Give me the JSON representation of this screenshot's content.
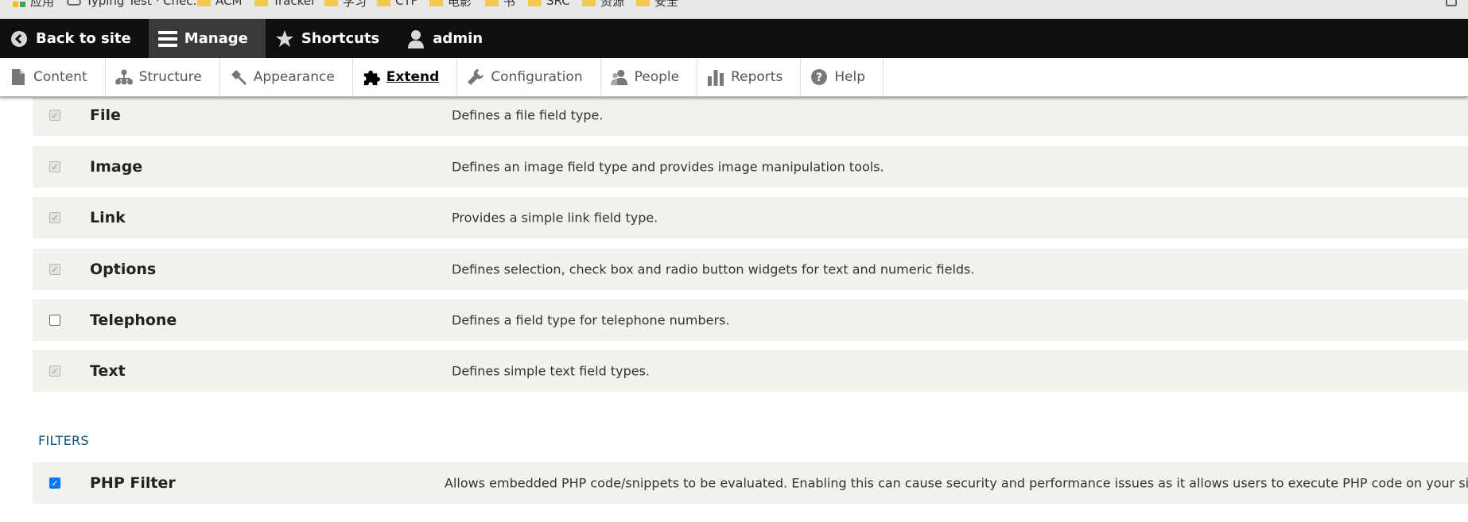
{
  "bookmarks": {
    "items": [
      {
        "icon": "apps-icon",
        "label": "应用"
      },
      {
        "icon": "cloud-icon",
        "label": "Typing Test · Chec..."
      },
      {
        "icon": "folder-icon",
        "label": "ACM"
      },
      {
        "icon": "folder-icon",
        "label": "Tracker"
      },
      {
        "icon": "folder-icon",
        "label": "学习"
      },
      {
        "icon": "folder-icon",
        "label": "CTF"
      },
      {
        "icon": "folder-icon",
        "label": "电影"
      },
      {
        "icon": "folder-icon",
        "label": "书"
      },
      {
        "icon": "folder-icon",
        "label": "SRC"
      },
      {
        "icon": "folder-icon",
        "label": "资源"
      },
      {
        "icon": "folder-icon",
        "label": "安全"
      }
    ]
  },
  "toolbar": {
    "back": "Back to site",
    "manage": "Manage",
    "shortcuts": "Shortcuts",
    "user": "admin"
  },
  "tray": {
    "items": [
      {
        "icon": "document-icon",
        "label": "Content"
      },
      {
        "icon": "sitemap-icon",
        "label": "Structure"
      },
      {
        "icon": "paintbrush-icon",
        "label": "Appearance"
      },
      {
        "icon": "puzzle-icon",
        "label": "Extend"
      },
      {
        "icon": "wrench-icon",
        "label": "Configuration"
      },
      {
        "icon": "people-icon",
        "label": "People"
      },
      {
        "icon": "bar-chart-icon",
        "label": "Reports"
      },
      {
        "icon": "help-icon",
        "label": "Help"
      }
    ],
    "active": "Extend"
  },
  "modules": {
    "field_types": [
      {
        "name": "File",
        "description": "Defines a file field type.",
        "state": "disabled-checked"
      },
      {
        "name": "Image",
        "description": "Defines an image field type and provides image manipulation tools.",
        "state": "disabled-checked"
      },
      {
        "name": "Link",
        "description": "Provides a simple link field type.",
        "state": "disabled-checked"
      },
      {
        "name": "Options",
        "description": "Defines selection, check box and radio button widgets for text and numeric fields.",
        "state": "disabled-checked"
      },
      {
        "name": "Telephone",
        "description": "Defines a field type for telephone numbers.",
        "state": "unchecked"
      },
      {
        "name": "Text",
        "description": "Defines simple text field types.",
        "state": "disabled-checked"
      }
    ],
    "filters_heading": "FILTERS",
    "filters": [
      {
        "name": "PHP Filter",
        "description": "Allows embedded PHP code/snippets to be evaluated. Enabling this can cause security and performance issues as it allows users to execute PHP code on your site.",
        "state": "checked"
      }
    ]
  },
  "colors": {
    "toolbar_bg": "#0f0f0f",
    "row_bg": "#f2f1eb",
    "heading_blue": "#0b4f82",
    "checkbox_blue": "#0075ff"
  }
}
